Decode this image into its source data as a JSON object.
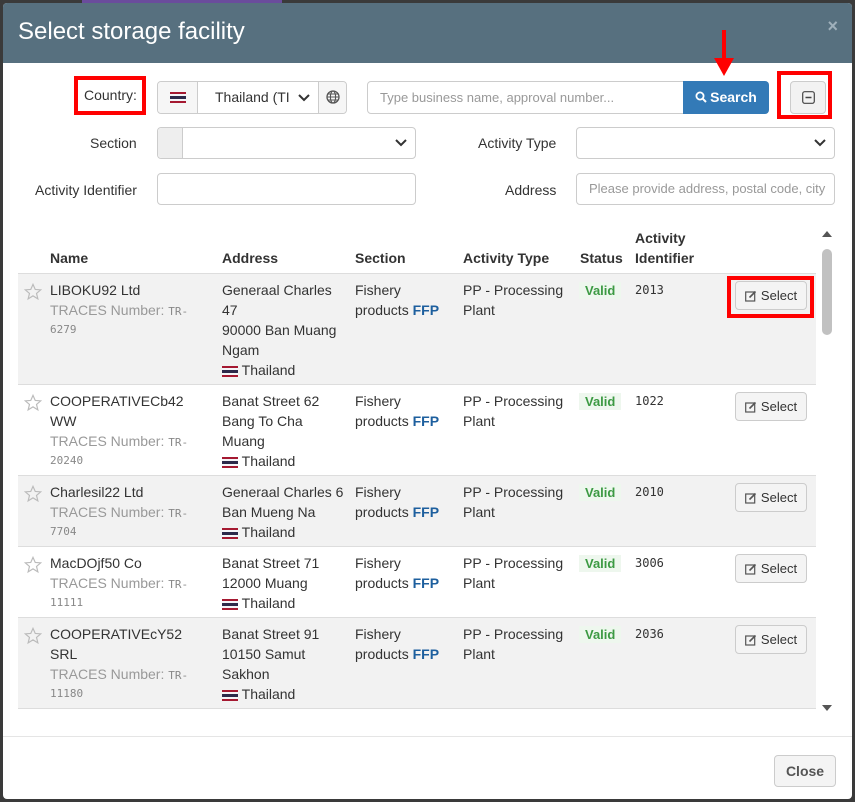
{
  "modal": {
    "title": "Select storage facility",
    "close_icon": "×"
  },
  "filters": {
    "country_label": "Country:",
    "country_value": "Thailand (TI",
    "search_placeholder": "Type business name, approval number...",
    "search_button": "Search",
    "section_label": "Section",
    "activity_type_label": "Activity Type",
    "activity_identifier_label": "Activity Identifier",
    "address_label": "Address",
    "address_placeholder": "Please provide address, postal code, city"
  },
  "table": {
    "headers": {
      "name": "Name",
      "address": "Address",
      "section": "Section",
      "activity_type": "Activity Type",
      "status": "Status",
      "activity_identifier_1": "Activity",
      "activity_identifier_2": "Identifier"
    },
    "traces_label": "TRACES Number:",
    "select_label": "Select",
    "rows": [
      {
        "name": "LIBOKU92 Ltd",
        "traces_prefix": "TR-",
        "traces_num": "6279",
        "addr1": "Generaal Charles",
        "addr2": "47",
        "addr3": "90000 Ban Muang",
        "addr4": "Ngam",
        "country": "Thailand",
        "section1": "Fishery",
        "section2": "products",
        "section_code": "FFP",
        "activity1": "PP - Processing",
        "activity2": "Plant",
        "status": "Valid",
        "identifier": "2013"
      },
      {
        "name1": "COOPERATIVECb42",
        "name2": "WW",
        "traces_prefix": "TR-",
        "traces_num": "20240",
        "addr1": "Banat Street 62",
        "addr2": "Bang To Cha",
        "addr3": "Muang",
        "country": "Thailand",
        "section1": "Fishery",
        "section2": "products",
        "section_code": "FFP",
        "activity1": "PP - Processing",
        "activity2": "Plant",
        "status": "Valid",
        "identifier": "1022"
      },
      {
        "name": "Charlesil22 Ltd",
        "traces_prefix": "TR-",
        "traces_num": "7704",
        "addr1": "Generaal Charles 6",
        "addr2": "Ban Mueng Na",
        "country": "Thailand",
        "section1": "Fishery",
        "section2": "products",
        "section_code": "FFP",
        "activity1": "PP - Processing",
        "activity2": "Plant",
        "status": "Valid",
        "identifier": "2010"
      },
      {
        "name": "MacDOjf50 Co",
        "traces_prefix": "TR-",
        "traces_num": "11111",
        "addr1": "Banat Street 71",
        "addr2": "12000 Muang",
        "country": "Thailand",
        "section1": "Fishery",
        "section2": "products",
        "section_code": "FFP",
        "activity1": "PP - Processing",
        "activity2": "Plant",
        "status": "Valid",
        "identifier": "3006"
      },
      {
        "name1": "COOPERATIVEcY52",
        "name2": "SRL",
        "traces_prefix": "TR-",
        "traces_num": "11180",
        "addr1": "Banat Street 91",
        "addr2": "10150 Samut",
        "addr3": "Sakhon",
        "country": "Thailand",
        "section1": "Fishery",
        "section2": "products",
        "section_code": "FFP",
        "activity1": "PP - Processing",
        "activity2": "Plant",
        "status": "Valid",
        "identifier": "2036"
      }
    ]
  },
  "footer": {
    "close_button": "Close"
  },
  "colors": {
    "header_bg": "#57707f",
    "primary": "#337ab7",
    "valid": "#3c9a43",
    "highlight": "#ff0000"
  }
}
